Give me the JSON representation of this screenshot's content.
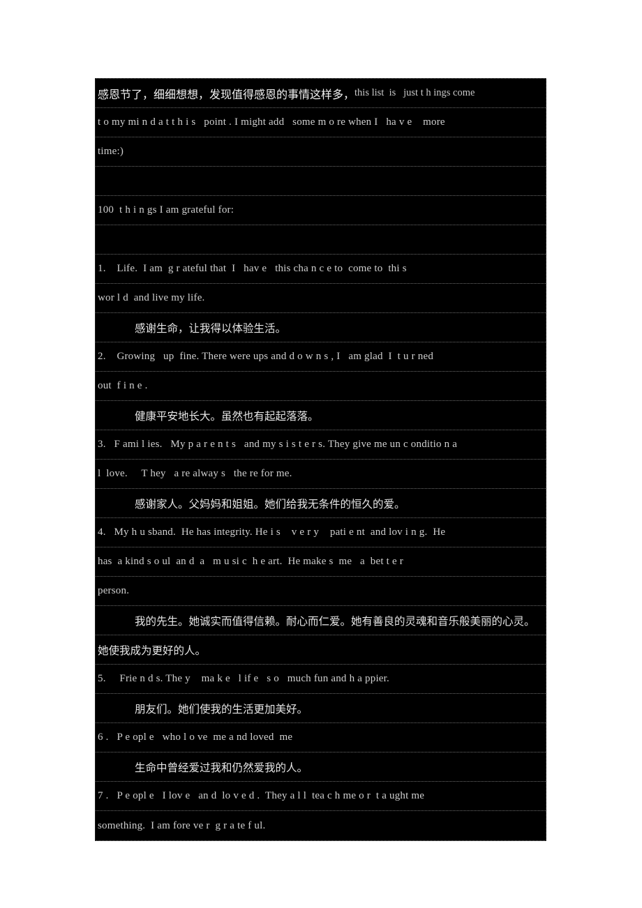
{
  "document": {
    "page_background": "#ffffff",
    "block_background": "#000000",
    "text_color": "#d8d8d8",
    "intro": {
      "zh_lead": "感恩节了，细细想想，发现值得感恩的事情这样多，",
      "en_lead": "this list  is   just t h ings come",
      "line2": "t o my mi n d a t t h i s   point . I might add   some m o re when I   ha v e    more",
      "line3": "time:)"
    },
    "heading": "100  t h i n gs I am grateful for:",
    "items": [
      {
        "number": "1.",
        "en_lines": [
          "1.    Life.  I am  g r ateful that  I   hav e   this cha n c e to  come to  thi s",
          "wor l d  and live my life."
        ],
        "zh_lines": [
          "感谢生命，让我得以体验生活。"
        ]
      },
      {
        "number": "2.",
        "en_lines": [
          "2.    Growing   up  fine. There were ups and d o w n s , I   am glad  I  t u r ned",
          "out  f i n e ."
        ],
        "zh_lines": [
          "健康平安地长大。虽然也有起起落落。"
        ]
      },
      {
        "number": "3.",
        "en_lines": [
          "3.   F ami l ies.   My p a r e n t s   and my s i s t e r s. They give me un c onditio n a",
          "l  love.     T hey   a re alway s   the re for me."
        ],
        "zh_lines": [
          "感谢家人。父妈妈和姐姐。她们给我无条件的恒久的爱。"
        ]
      },
      {
        "number": "4.",
        "en_lines": [
          "4.   My h u sband.  He has integrity. He i s    v e r y    pati e nt  and lov i n g.  He",
          "has  a kind s o ul  an d  a   m u si c  h e art.  He make s  me   a  bet t e r",
          "person."
        ],
        "zh_lines": [
          "我的先生。她诚实而值得信赖。耐心而仁爱。她有善良的灵魂和音乐般美丽的心灵。",
          "她使我成为更好的人。"
        ]
      },
      {
        "number": "5.",
        "en_lines": [
          "5.     Frie n d s. The y    ma k e   l if e   s o   much fun and h a ppier."
        ],
        "zh_lines": [
          "朋友们。她们使我的生活更加美好。"
        ]
      },
      {
        "number": "6.",
        "en_lines": [
          "6 .   P e opl e   who l o ve  me a nd loved  me"
        ],
        "zh_lines": [
          "生命中曾经爱过我和仍然爱我的人。"
        ]
      },
      {
        "number": "7.",
        "en_lines": [
          "7 .   P e opl e   I lov e   an d  lo v e d .  They a l l  tea c h me o r  t a ught me",
          "something.  I am fore ve r  g r a te f ul."
        ],
        "zh_lines": []
      }
    ],
    "blank_label": ""
  }
}
